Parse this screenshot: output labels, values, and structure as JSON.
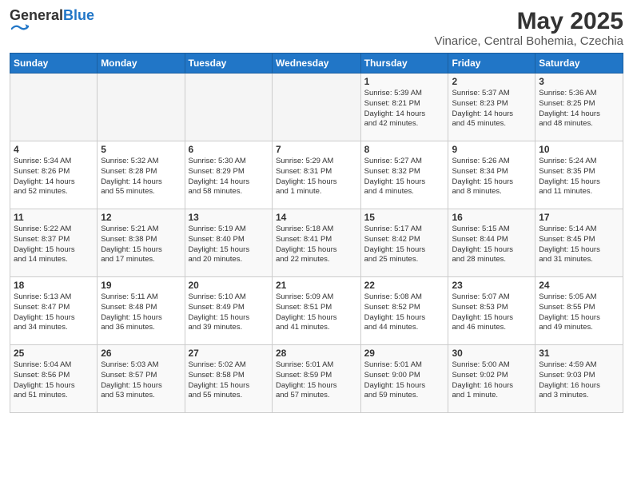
{
  "logo": {
    "general": "General",
    "blue": "Blue"
  },
  "title": "May 2025",
  "subtitle": "Vinarice, Central Bohemia, Czechia",
  "days_header": [
    "Sunday",
    "Monday",
    "Tuesday",
    "Wednesday",
    "Thursday",
    "Friday",
    "Saturday"
  ],
  "weeks": [
    [
      {
        "num": "",
        "info": ""
      },
      {
        "num": "",
        "info": ""
      },
      {
        "num": "",
        "info": ""
      },
      {
        "num": "",
        "info": ""
      },
      {
        "num": "1",
        "info": "Sunrise: 5:39 AM\nSunset: 8:21 PM\nDaylight: 14 hours\nand 42 minutes."
      },
      {
        "num": "2",
        "info": "Sunrise: 5:37 AM\nSunset: 8:23 PM\nDaylight: 14 hours\nand 45 minutes."
      },
      {
        "num": "3",
        "info": "Sunrise: 5:36 AM\nSunset: 8:25 PM\nDaylight: 14 hours\nand 48 minutes."
      }
    ],
    [
      {
        "num": "4",
        "info": "Sunrise: 5:34 AM\nSunset: 8:26 PM\nDaylight: 14 hours\nand 52 minutes."
      },
      {
        "num": "5",
        "info": "Sunrise: 5:32 AM\nSunset: 8:28 PM\nDaylight: 14 hours\nand 55 minutes."
      },
      {
        "num": "6",
        "info": "Sunrise: 5:30 AM\nSunset: 8:29 PM\nDaylight: 14 hours\nand 58 minutes."
      },
      {
        "num": "7",
        "info": "Sunrise: 5:29 AM\nSunset: 8:31 PM\nDaylight: 15 hours\nand 1 minute."
      },
      {
        "num": "8",
        "info": "Sunrise: 5:27 AM\nSunset: 8:32 PM\nDaylight: 15 hours\nand 4 minutes."
      },
      {
        "num": "9",
        "info": "Sunrise: 5:26 AM\nSunset: 8:34 PM\nDaylight: 15 hours\nand 8 minutes."
      },
      {
        "num": "10",
        "info": "Sunrise: 5:24 AM\nSunset: 8:35 PM\nDaylight: 15 hours\nand 11 minutes."
      }
    ],
    [
      {
        "num": "11",
        "info": "Sunrise: 5:22 AM\nSunset: 8:37 PM\nDaylight: 15 hours\nand 14 minutes."
      },
      {
        "num": "12",
        "info": "Sunrise: 5:21 AM\nSunset: 8:38 PM\nDaylight: 15 hours\nand 17 minutes."
      },
      {
        "num": "13",
        "info": "Sunrise: 5:19 AM\nSunset: 8:40 PM\nDaylight: 15 hours\nand 20 minutes."
      },
      {
        "num": "14",
        "info": "Sunrise: 5:18 AM\nSunset: 8:41 PM\nDaylight: 15 hours\nand 22 minutes."
      },
      {
        "num": "15",
        "info": "Sunrise: 5:17 AM\nSunset: 8:42 PM\nDaylight: 15 hours\nand 25 minutes."
      },
      {
        "num": "16",
        "info": "Sunrise: 5:15 AM\nSunset: 8:44 PM\nDaylight: 15 hours\nand 28 minutes."
      },
      {
        "num": "17",
        "info": "Sunrise: 5:14 AM\nSunset: 8:45 PM\nDaylight: 15 hours\nand 31 minutes."
      }
    ],
    [
      {
        "num": "18",
        "info": "Sunrise: 5:13 AM\nSunset: 8:47 PM\nDaylight: 15 hours\nand 34 minutes."
      },
      {
        "num": "19",
        "info": "Sunrise: 5:11 AM\nSunset: 8:48 PM\nDaylight: 15 hours\nand 36 minutes."
      },
      {
        "num": "20",
        "info": "Sunrise: 5:10 AM\nSunset: 8:49 PM\nDaylight: 15 hours\nand 39 minutes."
      },
      {
        "num": "21",
        "info": "Sunrise: 5:09 AM\nSunset: 8:51 PM\nDaylight: 15 hours\nand 41 minutes."
      },
      {
        "num": "22",
        "info": "Sunrise: 5:08 AM\nSunset: 8:52 PM\nDaylight: 15 hours\nand 44 minutes."
      },
      {
        "num": "23",
        "info": "Sunrise: 5:07 AM\nSunset: 8:53 PM\nDaylight: 15 hours\nand 46 minutes."
      },
      {
        "num": "24",
        "info": "Sunrise: 5:05 AM\nSunset: 8:55 PM\nDaylight: 15 hours\nand 49 minutes."
      }
    ],
    [
      {
        "num": "25",
        "info": "Sunrise: 5:04 AM\nSunset: 8:56 PM\nDaylight: 15 hours\nand 51 minutes."
      },
      {
        "num": "26",
        "info": "Sunrise: 5:03 AM\nSunset: 8:57 PM\nDaylight: 15 hours\nand 53 minutes."
      },
      {
        "num": "27",
        "info": "Sunrise: 5:02 AM\nSunset: 8:58 PM\nDaylight: 15 hours\nand 55 minutes."
      },
      {
        "num": "28",
        "info": "Sunrise: 5:01 AM\nSunset: 8:59 PM\nDaylight: 15 hours\nand 57 minutes."
      },
      {
        "num": "29",
        "info": "Sunrise: 5:01 AM\nSunset: 9:00 PM\nDaylight: 15 hours\nand 59 minutes."
      },
      {
        "num": "30",
        "info": "Sunrise: 5:00 AM\nSunset: 9:02 PM\nDaylight: 16 hours\nand 1 minute."
      },
      {
        "num": "31",
        "info": "Sunrise: 4:59 AM\nSunset: 9:03 PM\nDaylight: 16 hours\nand 3 minutes."
      }
    ]
  ]
}
